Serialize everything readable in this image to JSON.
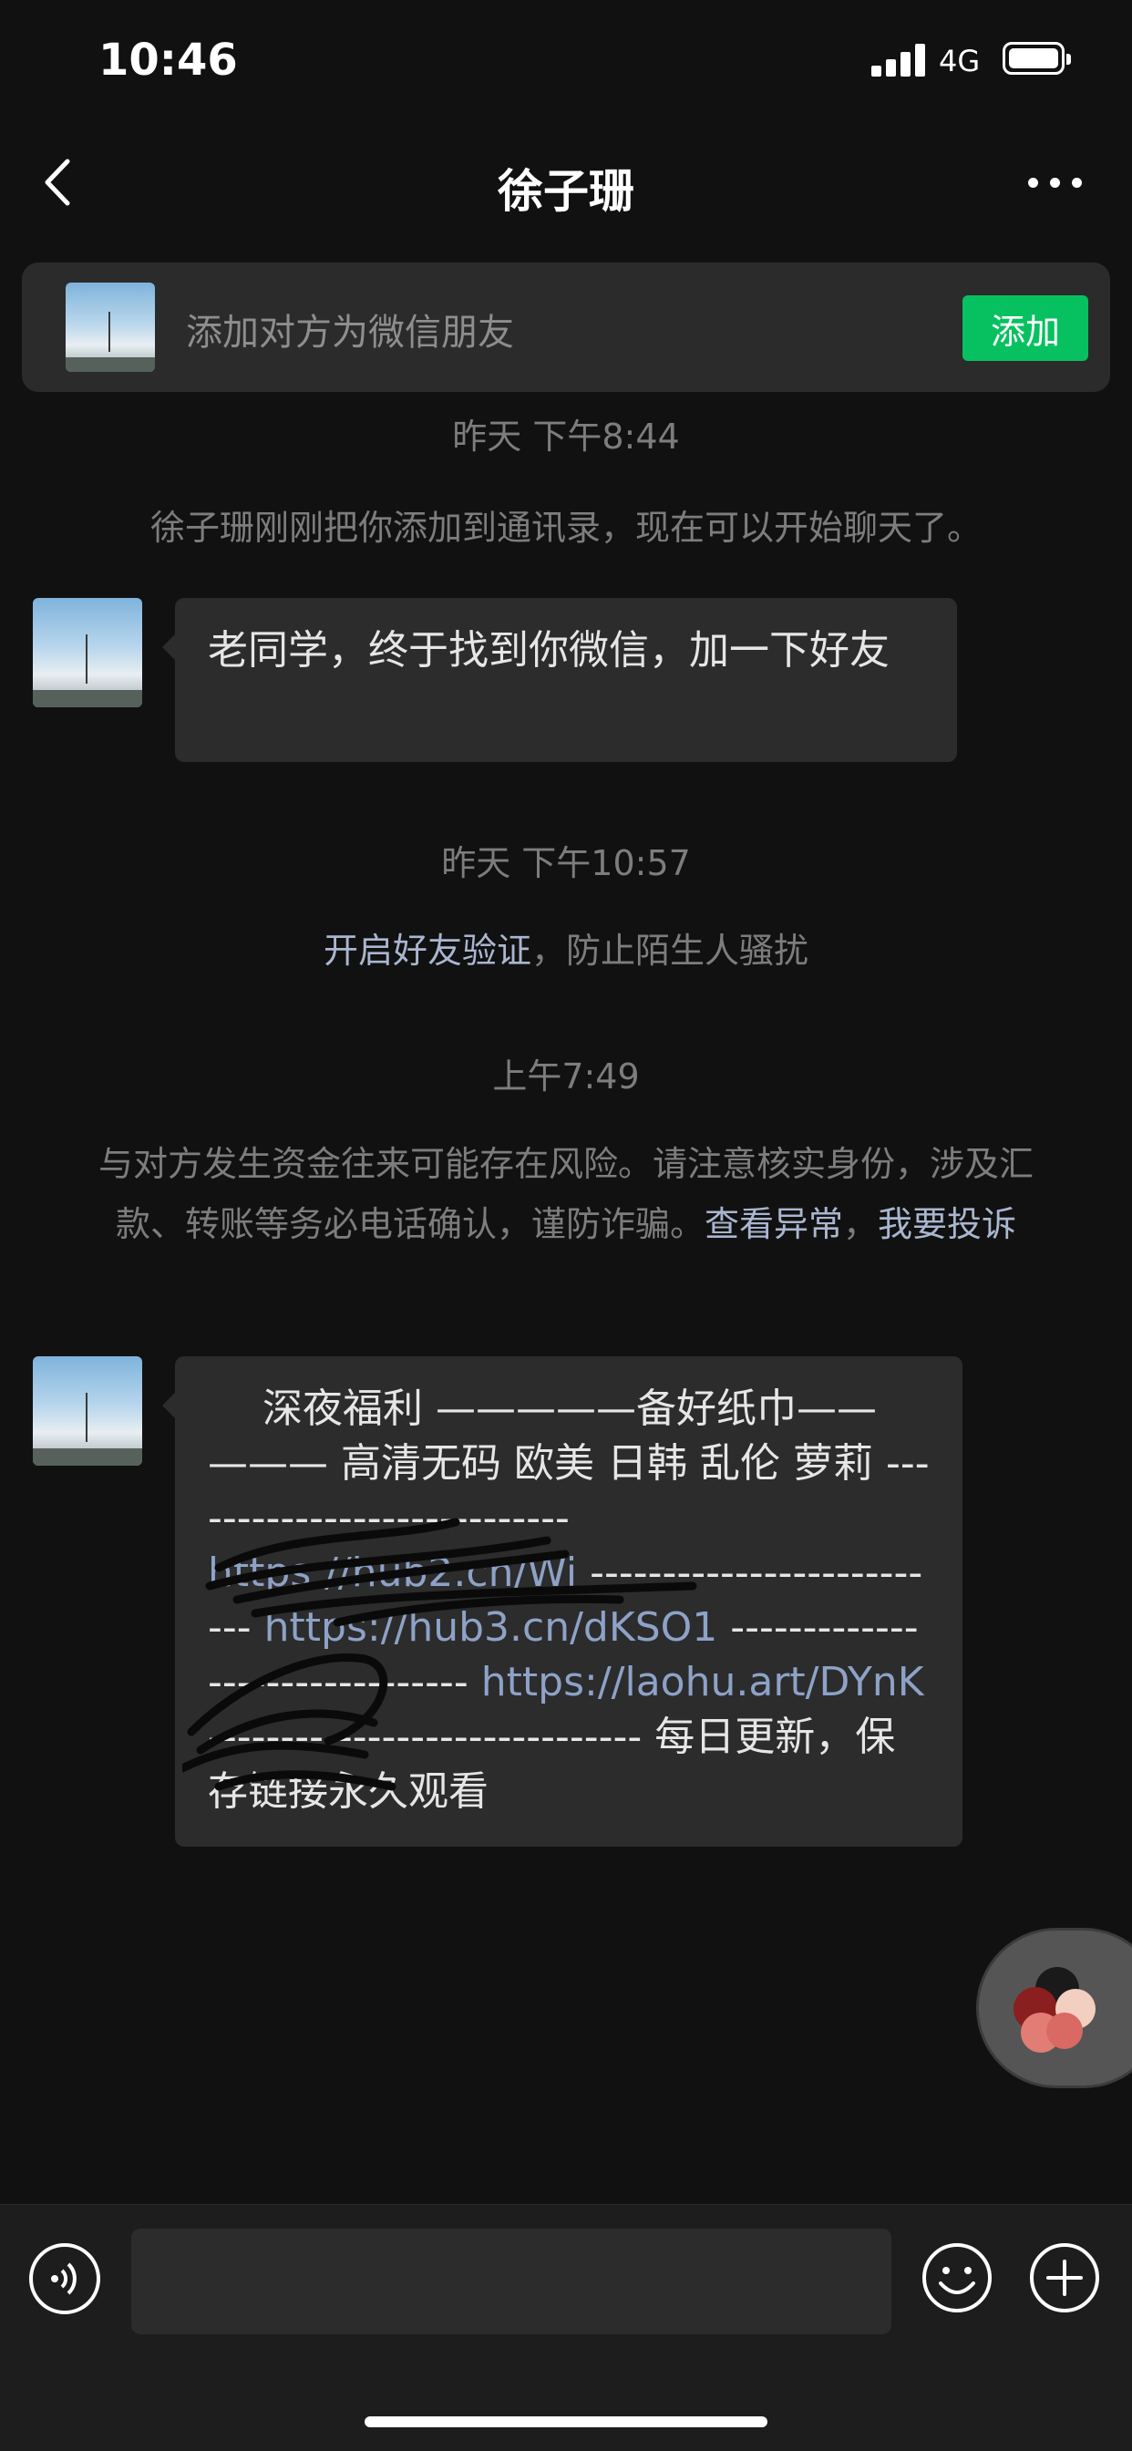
{
  "status_bar": {
    "time": "10:46",
    "network": "4G",
    "battery_level": 1.0
  },
  "header": {
    "back_icon": "chevron-left-icon",
    "title": "徐子珊",
    "more_icon": "more-dots-icon"
  },
  "add_banner": {
    "text": "添加对方为微信朋友",
    "button_label": "添加",
    "button_color": "#07c160"
  },
  "chat": {
    "time_1": "昨天 下午8:44",
    "system_added": "徐子珊刚刚把你添加到通讯录，现在可以开始聊天了。",
    "message_1": "老同学，终于找到你微信，加一下好友",
    "time_2": "昨天 下午10:57",
    "verify_link": "开启好友验证",
    "verify_rest": "，防止陌生人骚扰",
    "time_3": "上午7:49",
    "warning_text": "与对方发生资金往来可能存在风险。请注意核实身份，涉及汇款、转账等务必电话确认，谨防诈骗。",
    "warning_link_1": "查看异常",
    "warning_sep": "，",
    "warning_link_2": "我要投诉",
    "message_2": {
      "line_a": "深夜福利 ———",
      "line_b": "——备好纸巾——",
      "line_c": "——— 高清无码 欧美 日韩 乱伦 萝莉",
      "dashes_1": "---------------------------- ",
      "url_1": "https://hub2.cn/Wi",
      "dashes_2": " -------------------------- ",
      "url_2": "https://hub3.cn/dKSO1",
      "dashes_3": " ------------------------------- ",
      "url_3": "https://laohu.art/DYnK",
      "dashes_4": " ------------------------------ ",
      "tail": "每日更新，保存链接永久观看"
    }
  },
  "input_bar": {
    "voice_icon": "voice-icon",
    "emoji_icon": "emoji-icon",
    "plus_icon": "plus-icon",
    "input_value": ""
  }
}
